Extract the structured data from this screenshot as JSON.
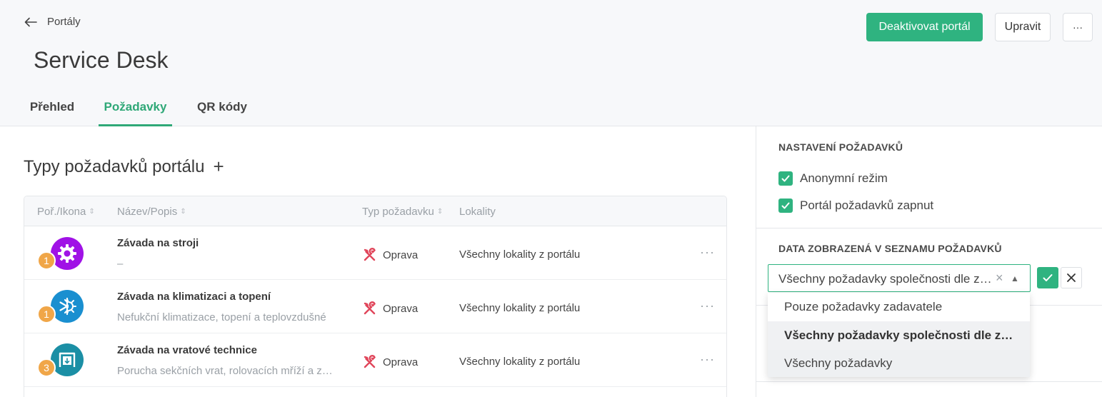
{
  "header": {
    "back_label": "Portály",
    "title": "Service Desk",
    "deactivate_label": "Deaktivovat portál",
    "edit_label": "Upravit",
    "more_label": "···"
  },
  "tabs": [
    {
      "label": "Přehled",
      "active": false
    },
    {
      "label": "Požadavky",
      "active": true
    },
    {
      "label": "QR kódy",
      "active": false
    }
  ],
  "main": {
    "section_title": "Typy požadavků portálu",
    "columns": {
      "order_icon": "Poř./Ikona",
      "name_desc": "Název/Popis",
      "type": "Typ požadavku",
      "locations": "Lokality"
    },
    "rows": [
      {
        "order": "1",
        "icon": "gear-icon",
        "icon_color": "#a012e6",
        "name": "Závada na stroji",
        "desc": "–",
        "type": "Oprava",
        "location": "Všechny lokality z portálu"
      },
      {
        "order": "1",
        "icon": "snowflake-sun-icon",
        "icon_color": "#1a8fd0",
        "name": "Závada na klimatizaci a topení",
        "desc": "Nefukční klimatizace, topení a teplovzdušné",
        "type": "Oprava",
        "location": "Všechny lokality z portálu"
      },
      {
        "order": "3",
        "icon": "garage-door-icon",
        "icon_color": "#1b8fa5",
        "name": "Závada na vratové technice",
        "desc": "Porucha sekčních vrat, rolovacích mříží a závor",
        "type": "Oprava",
        "location": "Všechny lokality z portálu"
      }
    ]
  },
  "settings": {
    "heading": "NASTAVENÍ POŽADAVKŮ",
    "anonymous_label": "Anonymní režim",
    "anonymous_checked": true,
    "portal_enabled_label": "Portál požadavků zapnut",
    "portal_enabled_checked": true,
    "data_heading": "DATA ZOBRAZENÁ V SEZNAMU POŽADAVKŮ",
    "select_value": "Všechny požadavky společnosti dle zadavatele",
    "options": [
      "Pouze požadavky zadavatele",
      "Všechny požadavky společnosti dle zadavatele",
      "Všechny požadavky"
    ]
  },
  "colors": {
    "accent": "#2fb380",
    "badge": "#f0a648",
    "repair_icon": "#e0455a"
  }
}
